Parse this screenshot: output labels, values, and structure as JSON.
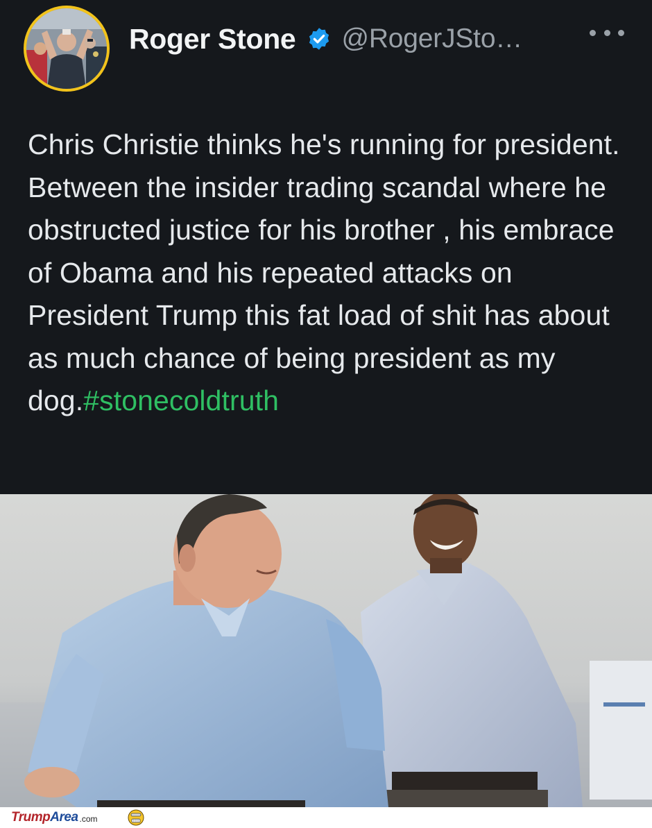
{
  "tweet": {
    "display_name": "Roger Stone",
    "handle": "@RogerJSto…",
    "text_parts": [
      "Chris Christie thinks he's running for president. Between the insider trading scandal where he obstructed justice for his brother , his embrace of Obama and his repeated attacks on President Trump this fat load of shit has about as much chance of being president as my dog."
    ],
    "hashtag": "#stonecoldtruth",
    "icons": {
      "verified": "verified-badge-icon",
      "more": "more-options-icon"
    },
    "colors": {
      "background": "#15181c",
      "hashtag": "#2fbf63",
      "verified": "#1d9bf0",
      "avatar_ring": "#f2c31b"
    }
  },
  "footer": {
    "brand_main": "Trump",
    "brand_accent": "Area",
    "brand_tld": ".com"
  }
}
